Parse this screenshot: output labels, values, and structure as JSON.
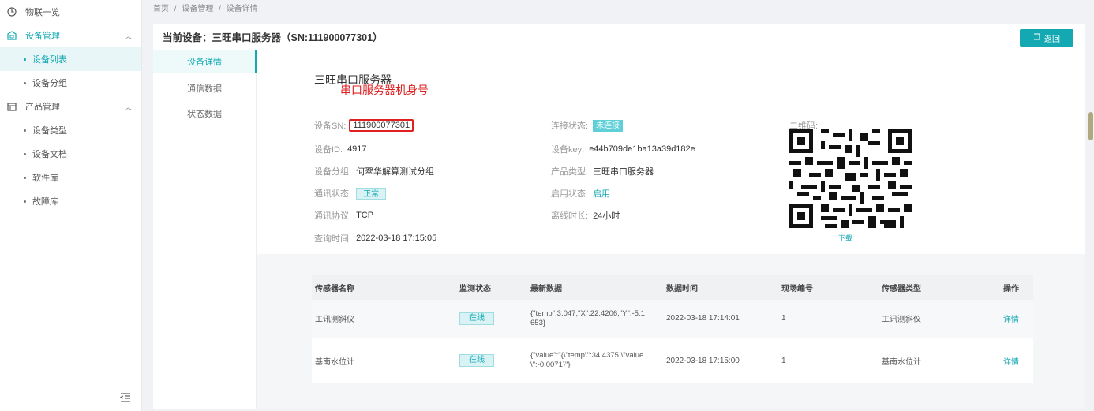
{
  "sidebar": {
    "items": [
      {
        "label": "物联一览",
        "icon": "clock-icon"
      },
      {
        "label": "设备管理",
        "icon": "device-icon",
        "expanded": true
      },
      {
        "label": "设备列表",
        "active": true
      },
      {
        "label": "设备分组"
      },
      {
        "label": "产品管理",
        "icon": "product-icon",
        "expanded": true
      },
      {
        "label": "设备类型"
      },
      {
        "label": "设备文档"
      },
      {
        "label": "软件库"
      },
      {
        "label": "故障库"
      }
    ],
    "collapse_icon": "collapse-icon"
  },
  "breadcrumb": [
    "首页",
    "/",
    "设备管理",
    "/",
    "设备详情"
  ],
  "header": {
    "title": "当前设备：三旺串口服务器（SN:111900077301）",
    "back_label": "返回",
    "back_icon": "back-icon"
  },
  "tabs": [
    "设备详情",
    "通信数据",
    "状态数据"
  ],
  "device": {
    "name": "三旺串口服务器",
    "annotation": "串口服务器机身号",
    "sn_label": "设备SN:",
    "sn_value": "111900077301",
    "id_label": "设备ID:",
    "id_value": "4917",
    "group_label": "设备分组:",
    "group_value": "何翠华解算测试分组",
    "comm_status_label": "通讯状态:",
    "comm_status_value": "正常",
    "protocol_label": "通讯协议:",
    "protocol_value": "TCP",
    "query_time_label": "查询时间:",
    "query_time_value": "2022-03-18 17:15:05",
    "conn_status_label": "连接状态:",
    "conn_status_value": "未连接",
    "key_label": "设备key:",
    "key_value": "e44b709de1ba13a39d182e",
    "product_type_label": "产品类型:",
    "product_type_value": "三旺串口服务器",
    "enable_status_label": "启用状态:",
    "enable_status_value": "启用",
    "offline_label": "离线时长:",
    "offline_value": "24小时",
    "qr_label": "二维码:",
    "download_label": "下载"
  },
  "table": {
    "columns": [
      "传感器名称",
      "监测状态",
      "最新数据",
      "数据时间",
      "现场编号",
      "传感器类型",
      "操作"
    ],
    "rows": [
      {
        "name": "工讯测斜仪",
        "status": "在线",
        "latest": "{\"temp\":3.047,\"X\":22.4206,\"Y\":-5.1653}",
        "time": "2022-03-18 17:14:01",
        "site_no": "1",
        "type": "工讯测斜仪",
        "action": "详情"
      },
      {
        "name": "基南水位计",
        "status": "在线",
        "latest": "{\"value\":\"{\\\"temp\\\":34.4375,\\\"value\\\":-0.0071}\"}",
        "time": "2022-03-18 17:15:00",
        "site_no": "1",
        "type": "基南水位计",
        "action": "详情"
      }
    ]
  },
  "colors": {
    "accent": "#13a8b2",
    "annotation": "#e02020"
  }
}
